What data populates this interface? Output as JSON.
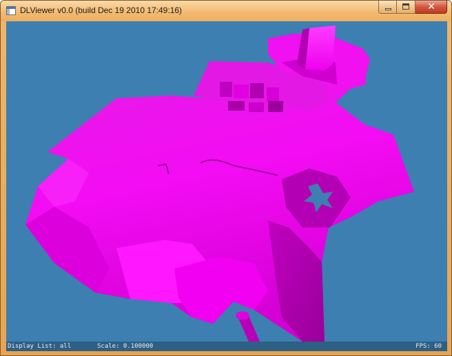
{
  "window": {
    "title": "DLViewer v0.0 (build Dec 19 2010 17:49:16)",
    "icon": "app-window-icon",
    "buttons": {
      "minimize_icon": "minimize-icon",
      "maximize_icon": "maximize-icon",
      "close_icon": "close-icon",
      "close_glyph": "✕"
    }
  },
  "viewport": {
    "background_color": "#3c7fb0",
    "mesh_color": "#ff00ff"
  },
  "status": {
    "display_list": "Display List: all",
    "scale": "Scale: 0.100000",
    "fps": "FPS: 60"
  }
}
